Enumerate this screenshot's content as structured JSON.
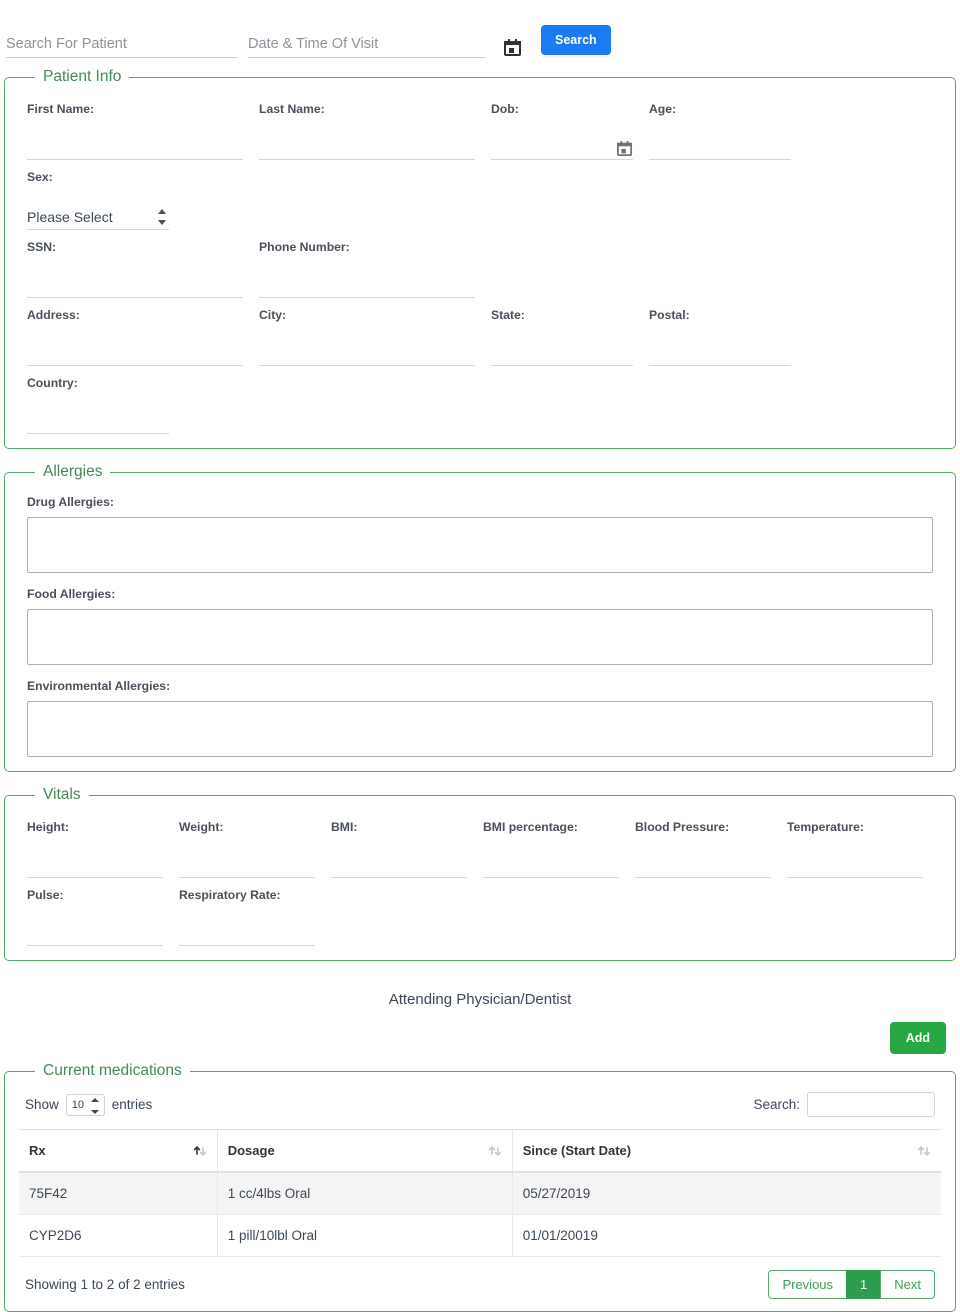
{
  "search_bar": {
    "patient_search_placeholder": "Search For Patient",
    "visit_date_placeholder": "Date & Time Of Visit",
    "patient_search_value": "",
    "visit_date_value": "",
    "calendar_icon": "calendar-icon",
    "search_button_label": "Search",
    "search_button_color": "#1a7cf0"
  },
  "patient_info": {
    "legend": "Patient Info",
    "row1": [
      {
        "label": "First Name:",
        "value": ""
      },
      {
        "label": "Last Name:",
        "value": ""
      },
      {
        "label": "Dob:",
        "value": "",
        "icon": "calendar-icon"
      },
      {
        "label": "Age:",
        "value": ""
      },
      {
        "label": "Sex:",
        "selected": "Please Select"
      }
    ],
    "row2": [
      {
        "label": "SSN:",
        "value": ""
      },
      {
        "label": "Phone Number:",
        "value": ""
      }
    ],
    "row3": [
      {
        "label": "Address:",
        "value": ""
      },
      {
        "label": "City:",
        "value": ""
      },
      {
        "label": "State:",
        "value": ""
      },
      {
        "label": "Postal:",
        "value": ""
      },
      {
        "label": "Country:",
        "value": ""
      }
    ]
  },
  "allergies": {
    "legend": "Allergies",
    "fields": [
      {
        "label": "Drug Allergies:",
        "value": ""
      },
      {
        "label": "Food Allergies:",
        "value": ""
      },
      {
        "label": "Environmental Allergies:",
        "value": ""
      }
    ]
  },
  "vitals": {
    "legend": "Vitals",
    "row1": [
      {
        "label": "Height:",
        "value": ""
      },
      {
        "label": "Weight:",
        "value": ""
      },
      {
        "label": "BMI:",
        "value": ""
      },
      {
        "label": "BMI percentage:",
        "value": ""
      },
      {
        "label": "Blood Pressure:",
        "value": ""
      },
      {
        "label": "Temperature:",
        "value": ""
      }
    ],
    "row2": [
      {
        "label": "Pulse:",
        "value": ""
      },
      {
        "label": "Respiratory Rate:",
        "value": ""
      }
    ]
  },
  "attending": {
    "title": "Attending Physician/Dentist",
    "add_button_label": "Add",
    "add_button_color": "#28a745"
  },
  "medications": {
    "legend": "Current medications",
    "show_label": "Show",
    "entries_label": "entries",
    "page_length": "10",
    "search_label": "Search:",
    "search_value": "",
    "columns": [
      {
        "label": "Rx",
        "sort": "asc"
      },
      {
        "label": "Dosage",
        "sort": "none"
      },
      {
        "label": "Since (Start Date)",
        "sort": "none"
      }
    ],
    "rows": [
      {
        "rx": "75F42",
        "dosage": "1 cc/4lbs Oral",
        "since": "05/27/2019"
      },
      {
        "rx": "CYP2D6",
        "dosage": "1 pill/10lbl Oral",
        "since": "01/01/20019"
      }
    ],
    "info": "Showing 1 to 2 of 2 entries",
    "pagination": {
      "previous": "Previous",
      "pages": [
        "1"
      ],
      "next": "Next",
      "active_page": "1",
      "accent": "#2d9c4f"
    }
  },
  "theme": {
    "panel_border": "#53a869",
    "legend_text": "#45885a"
  }
}
